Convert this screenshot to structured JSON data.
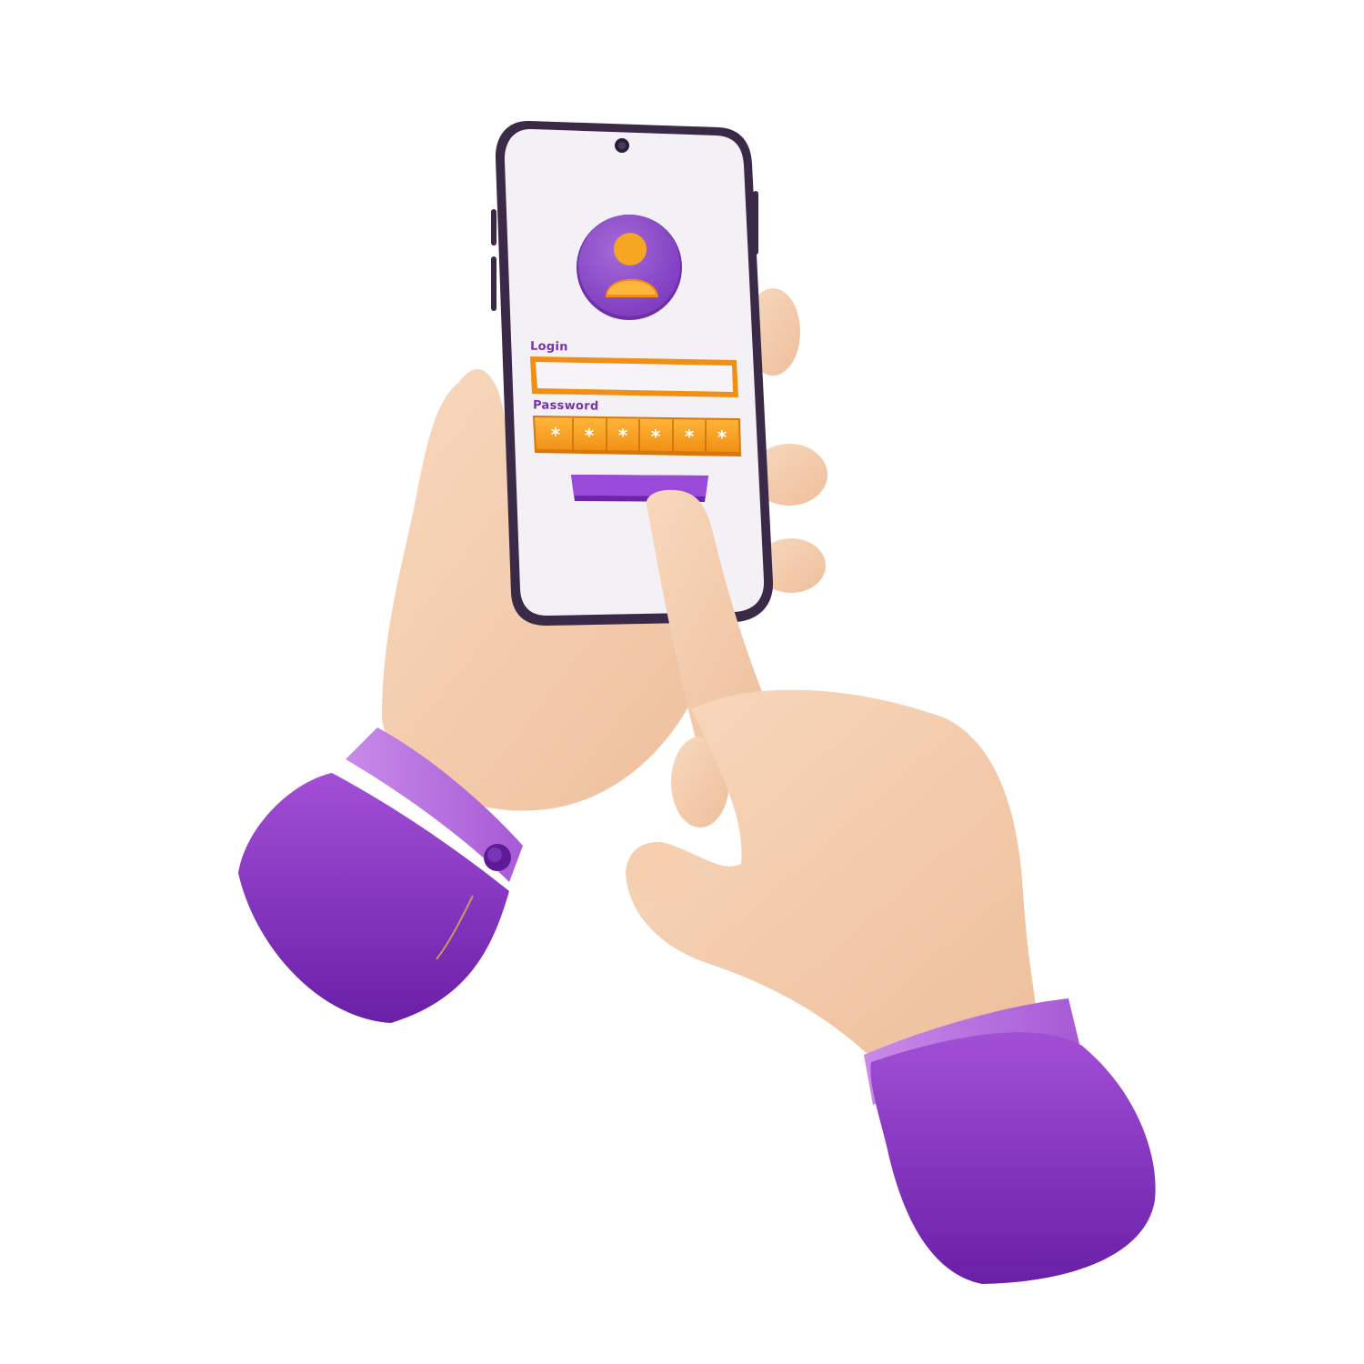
{
  "login_form": {
    "login_label": "Login",
    "login_value": "",
    "password_label": "Password",
    "password_mask": [
      "*",
      "*",
      "*",
      "*",
      "*",
      "*"
    ],
    "submit_label": ""
  },
  "icons": {
    "avatar": "user-avatar-icon",
    "camera": "front-camera-icon"
  },
  "colors": {
    "accent_purple": "#8a3fc9",
    "accent_orange": "#f5a623",
    "skin": "#f3c9a7",
    "screen_bg": "#f4f1f6",
    "phone_frame": "#3a2a48"
  }
}
